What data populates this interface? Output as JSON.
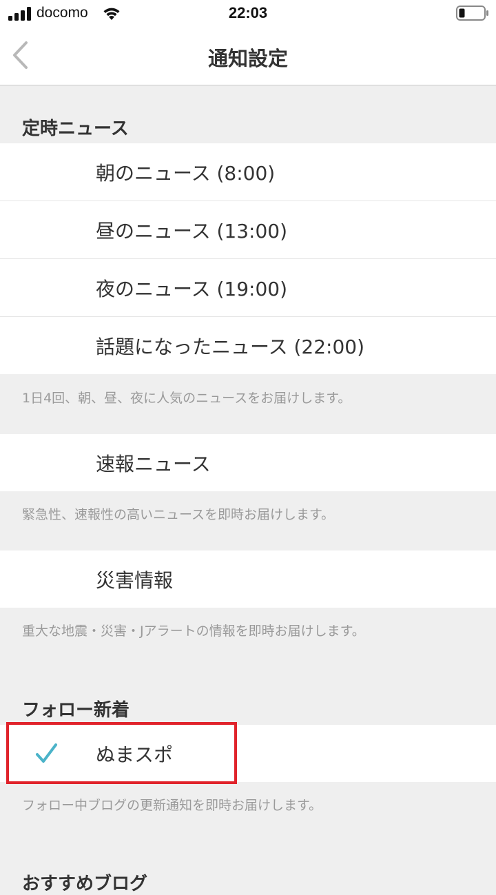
{
  "status_bar": {
    "carrier": "docomo",
    "time": "22:03",
    "signal_icon": "signal-bars-icon",
    "wifi_icon": "wifi-icon",
    "battery_icon": "battery-low-icon"
  },
  "nav": {
    "title": "通知設定",
    "back_icon": "chevron-left-icon"
  },
  "sections": {
    "scheduled": {
      "header": "定時ニュース",
      "items": [
        {
          "label": "朝のニュース (8:00)",
          "checked": false
        },
        {
          "label": "昼のニュース (13:00)",
          "checked": false
        },
        {
          "label": "夜のニュース (19:00)",
          "checked": false
        },
        {
          "label": "話題になったニュース (22:00)",
          "checked": false
        }
      ],
      "description": "1日4回、朝、昼、夜に人気のニュースをお届けします。"
    },
    "breaking": {
      "items": [
        {
          "label": "速報ニュース",
          "checked": false
        }
      ],
      "description": "緊急性、速報性の高いニュースを即時お届けします。"
    },
    "disaster": {
      "items": [
        {
          "label": "災害情報",
          "checked": false
        }
      ],
      "description": "重大な地震・災害・Jアラートの情報を即時お届けします。"
    },
    "follow": {
      "header": "フォロー新着",
      "items": [
        {
          "label": "ぬまスポ",
          "checked": true
        }
      ],
      "description": "フォロー中ブログの更新通知を即時お届けします。"
    },
    "recommended": {
      "header": "おすすめブログ"
    }
  },
  "colors": {
    "check": "#4bb3c9",
    "highlight": "#e0232b",
    "background": "#efefef"
  }
}
